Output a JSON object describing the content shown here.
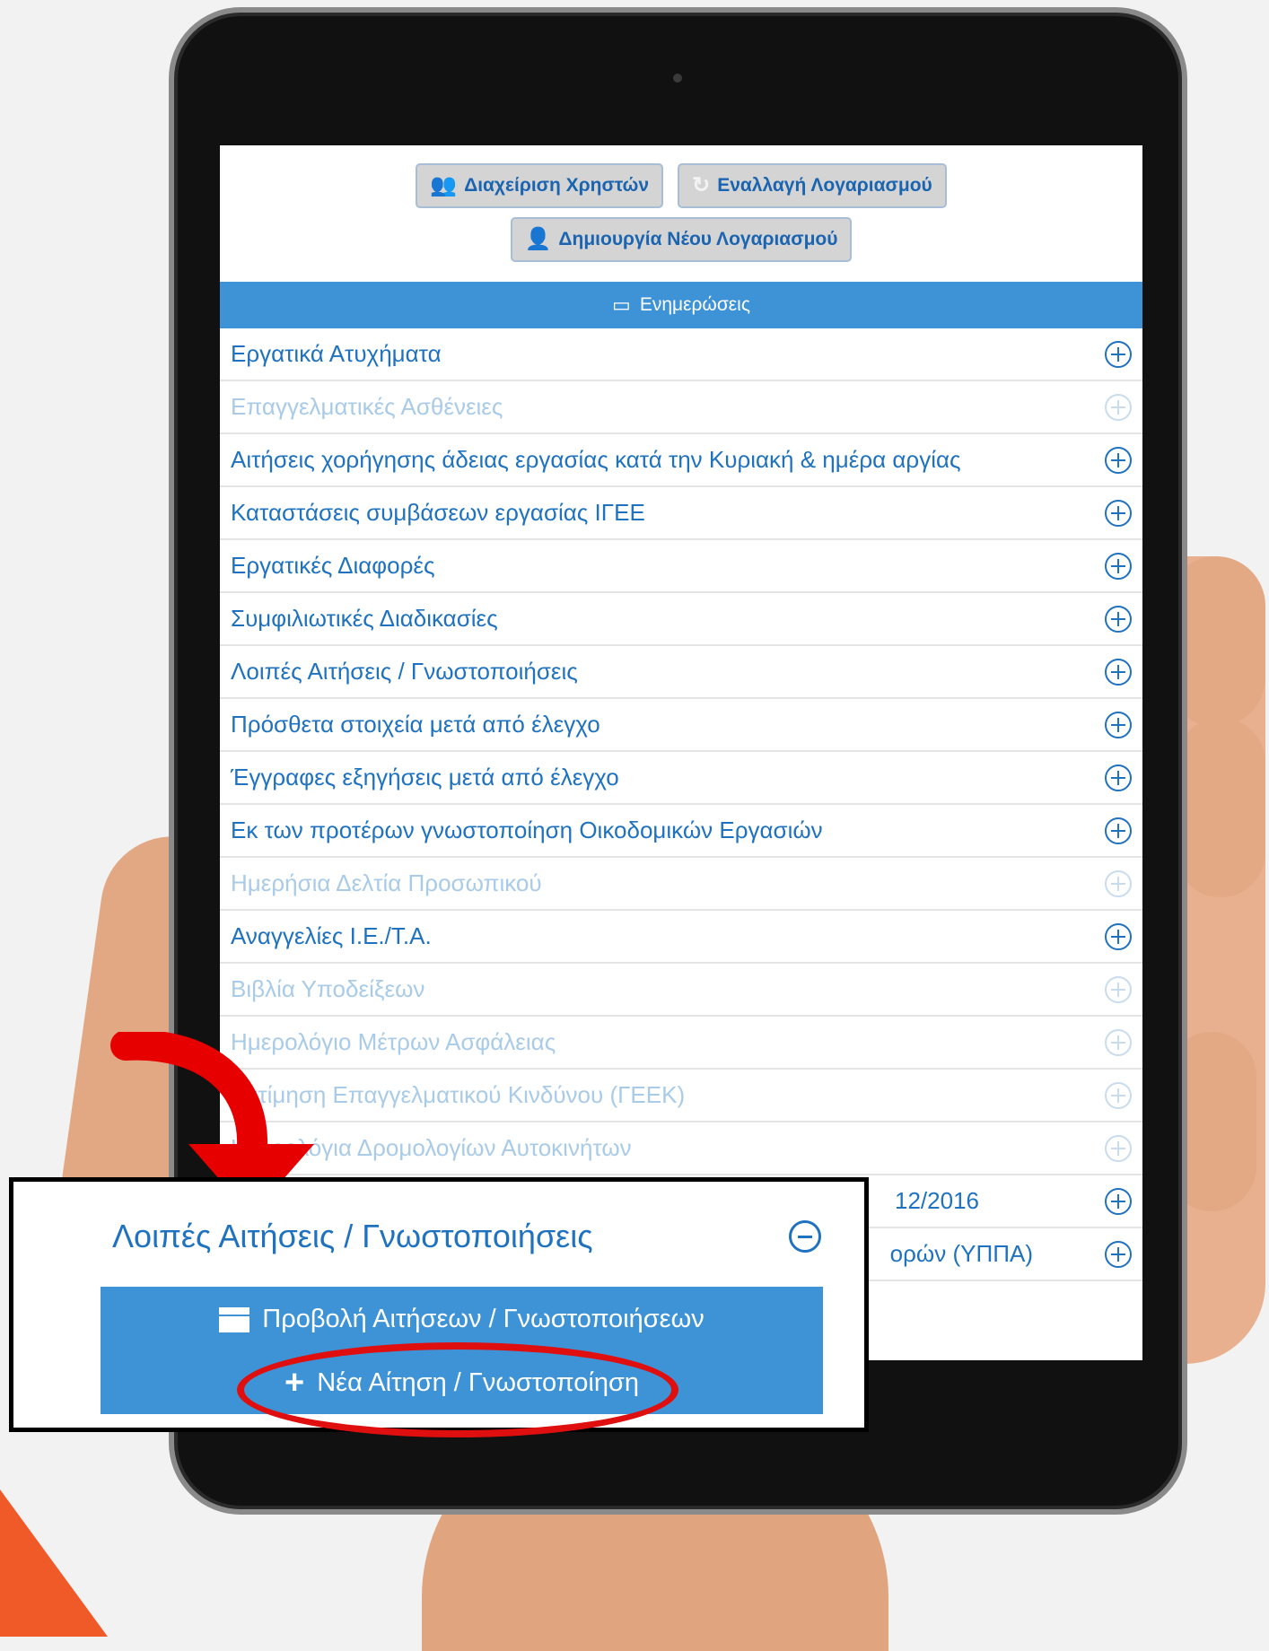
{
  "toolbar": {
    "user_management_label": "Διαχείριση Χρηστών",
    "switch_account_label": "Εναλλαγή Λογαριασμού",
    "new_account_label": "Δημιουργία Νέου Λογαριασμού"
  },
  "banner": {
    "label": "Ενημερώσεις"
  },
  "menu": {
    "items": [
      {
        "label": "Εργατικά Ατυχήματα",
        "enabled": true
      },
      {
        "label": "Επαγγελματικές Ασθένειες",
        "enabled": false
      },
      {
        "label": "Αιτήσεις χορήγησης άδειας εργασίας κατά την Κυριακή & ημέρα αργίας",
        "enabled": true
      },
      {
        "label": "Καταστάσεις συμβάσεων εργασίας ΙΓΕΕ",
        "enabled": true
      },
      {
        "label": "Εργατικές Διαφορές",
        "enabled": true
      },
      {
        "label": "Συμφιλιωτικές Διαδικασίες",
        "enabled": true
      },
      {
        "label": "Λοιπές Αιτήσεις / Γνωστοποιήσεις",
        "enabled": true
      },
      {
        "label": "Πρόσθετα στοιχεία μετά από έλεγχο",
        "enabled": true
      },
      {
        "label": "Έγγραφες εξηγήσεις μετά από έλεγχο",
        "enabled": true
      },
      {
        "label": "Εκ των προτέρων γνωστοποίηση Οικοδομικών Εργασιών",
        "enabled": true
      },
      {
        "label": "Ημερήσια Δελτία Προσωπικού",
        "enabled": false
      },
      {
        "label": "Αναγγελίες Ι.Ε./Τ.Α.",
        "enabled": true
      },
      {
        "label": "Βιβλία Υποδείξεων",
        "enabled": false
      },
      {
        "label": "Ημερολόγιο Μέτρων Ασφάλειας",
        "enabled": false
      },
      {
        "label": "Εκτίμηση Επαγγελματικού Κινδύνου (ΓΕΕΚ)",
        "enabled": false
      },
      {
        "label": "Ημερολόγια Δρομολογίων Αυτοκινήτων",
        "enabled": false
      },
      {
        "label": "12/2016",
        "enabled": true
      },
      {
        "label": "ορών (ΥΠΠΑ)",
        "enabled": true
      }
    ]
  },
  "zoom": {
    "section_title": "Λοιπές Αιτήσεις / Γνωστοποιήσεις",
    "view_label": "Προβολή Αιτήσεων / Γνωστοποιήσεων",
    "new_label": "Νέα Αίτηση / Γνωστοποίηση"
  },
  "icons": {
    "users": "users-icon",
    "refresh": "refresh-icon",
    "add_user": "add-user-icon",
    "inbox": "inbox-icon",
    "expand": "plus-circle-icon",
    "collapse": "minus-circle-icon",
    "archive": "archive-icon",
    "add": "plus-icon"
  },
  "colors": {
    "accent_blue": "#3e93d6",
    "link_blue": "#1f72bf",
    "disabled_blue": "#a9cbe8",
    "highlight_red": "#e00f0f",
    "arrow_red": "#e60000",
    "orange": "#f05a28"
  }
}
